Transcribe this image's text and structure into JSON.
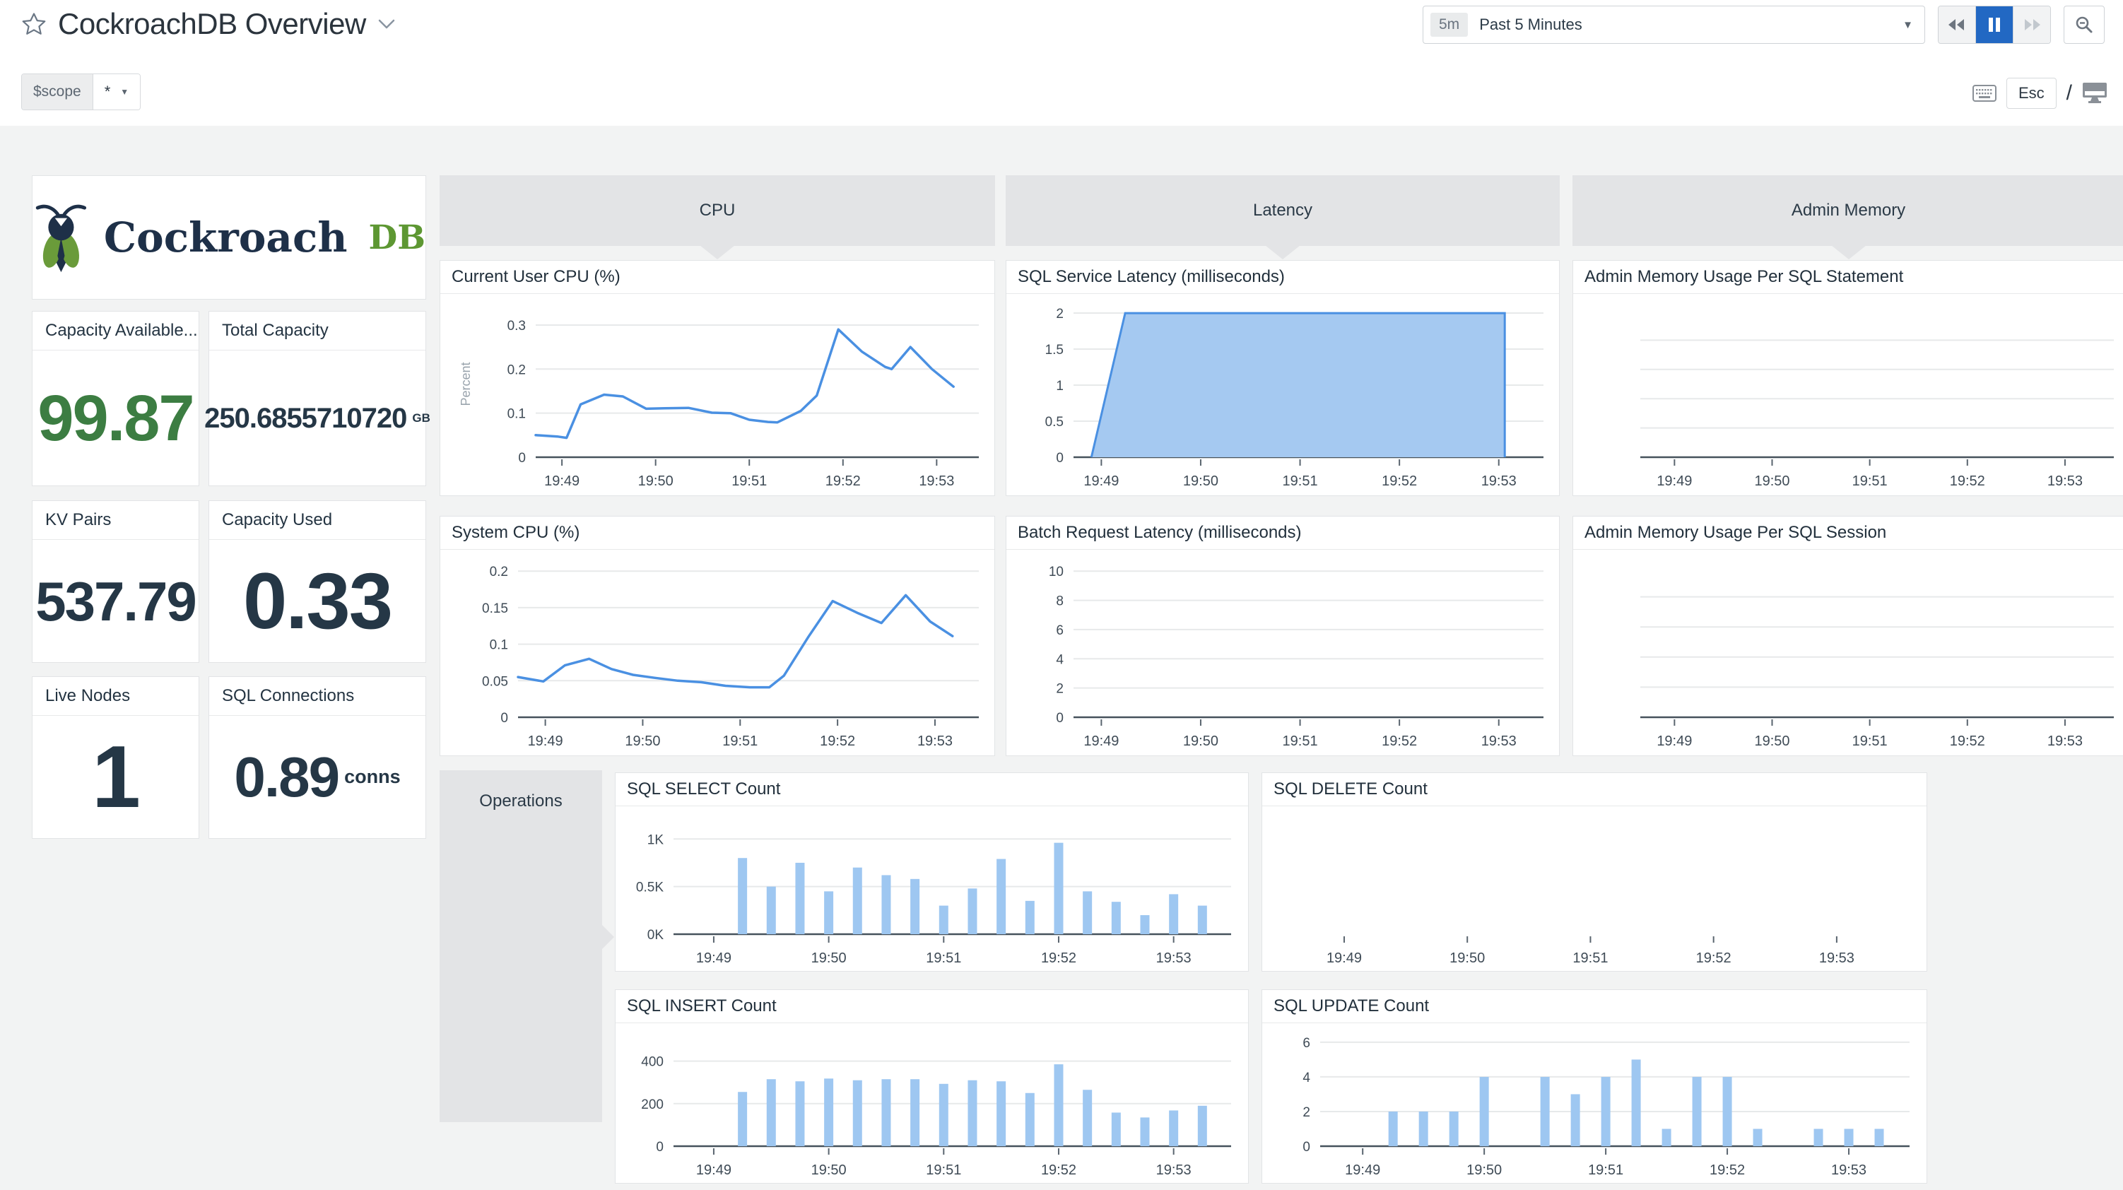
{
  "header": {
    "title": "CockroachDB Overview",
    "time_range": {
      "badge": "5m",
      "label": "Past 5 Minutes",
      "caret": "▼"
    },
    "scope_var": {
      "name": "$scope",
      "value": "*",
      "caret": "▼"
    },
    "esc_label": "Esc",
    "slash": "/"
  },
  "icons": {
    "favorite": "star-outline",
    "title_menu": "chevron-down",
    "rewind": "double-triangle-left",
    "pause": "pause-bars",
    "forward": "double-triangle-right",
    "zoom_out": "magnifier-minus",
    "keyboard": "keyboard",
    "display": "monitor"
  },
  "logo": {
    "brand": "Cockroach",
    "suffix": "DB"
  },
  "colors": {
    "accent_blue": "#2268c3",
    "line_blue": "#4a90e2",
    "area_fill": "#a5c9f1",
    "bar_fill": "#9ec7f1",
    "value_green": "#3c7d42",
    "logo_navy": "#1e3048",
    "logo_green": "#5d9732"
  },
  "groups": {
    "cpu": "CPU",
    "latency": "Latency",
    "admin_memory": "Admin Memory",
    "operations": "Operations"
  },
  "stats": [
    {
      "title": "Capacity Available...",
      "value": "99.87",
      "unit": "",
      "color": "#3c7d42"
    },
    {
      "title": "Total Capacity",
      "value": "250.6855710720",
      "unit": "GB",
      "color": "#253746"
    },
    {
      "title": "KV Pairs",
      "value": "537.79",
      "unit": "",
      "color": "#253746"
    },
    {
      "title": "Capacity Used",
      "value": "0.33",
      "unit": "",
      "color": "#253746"
    },
    {
      "title": "Live Nodes",
      "value": "1",
      "unit": "",
      "color": "#253746"
    },
    {
      "title": "SQL Connections",
      "value": "0.89",
      "unit": "conns",
      "color": "#253746"
    }
  ],
  "chart_data": [
    {
      "id": "current_user_cpu",
      "type": "line",
      "title": "Current User CPU (%)",
      "ylabel": "Percent",
      "ylim": [
        0,
        0.332
      ],
      "yticks": [
        {
          "v": 0,
          "t": "0"
        },
        {
          "v": 0.1,
          "t": "0.1"
        },
        {
          "v": 0.2,
          "t": "0.2"
        },
        {
          "v": 0.3,
          "t": "0.3"
        }
      ],
      "xlim": [
        48.72,
        53.45
      ],
      "xticks": [
        {
          "v": 49,
          "t": "19:49"
        },
        {
          "v": 50,
          "t": "19:50"
        },
        {
          "v": 51,
          "t": "19:51"
        },
        {
          "v": 52,
          "t": "19:52"
        },
        {
          "v": 53,
          "t": "19:53"
        }
      ],
      "points": [
        [
          48.72,
          0.05
        ],
        [
          48.95,
          0.047
        ],
        [
          49.05,
          0.044
        ],
        [
          49.2,
          0.12
        ],
        [
          49.45,
          0.142
        ],
        [
          49.65,
          0.138
        ],
        [
          49.9,
          0.11
        ],
        [
          50.1,
          0.111
        ],
        [
          50.35,
          0.112
        ],
        [
          50.6,
          0.101
        ],
        [
          50.8,
          0.1
        ],
        [
          51.0,
          0.085
        ],
        [
          51.2,
          0.08
        ],
        [
          51.3,
          0.079
        ],
        [
          51.55,
          0.105
        ],
        [
          51.72,
          0.14
        ],
        [
          51.95,
          0.29
        ],
        [
          52.2,
          0.24
        ],
        [
          52.45,
          0.205
        ],
        [
          52.52,
          0.2
        ],
        [
          52.72,
          0.25
        ],
        [
          52.95,
          0.2
        ],
        [
          53.18,
          0.16
        ]
      ],
      "color": "#4a90e2",
      "margins": {
        "l": 135,
        "r": 22,
        "t": 24,
        "b": 54
      }
    },
    {
      "id": "sql_service_latency",
      "type": "area",
      "title": "SQL Service Latency (milliseconds)",
      "ylim": [
        0,
        2.03
      ],
      "yticks": [
        {
          "v": 0,
          "t": "0"
        },
        {
          "v": 0.5,
          "t": "0.5"
        },
        {
          "v": 1,
          "t": "1"
        },
        {
          "v": 1.5,
          "t": "1.5"
        },
        {
          "v": 2,
          "t": "2"
        }
      ],
      "xlim": [
        48.72,
        53.45
      ],
      "xticks": [
        {
          "v": 49,
          "t": "19:49"
        },
        {
          "v": 50,
          "t": "19:50"
        },
        {
          "v": 51,
          "t": "19:51"
        },
        {
          "v": 52,
          "t": "19:52"
        },
        {
          "v": 53,
          "t": "19:53"
        }
      ],
      "points": [
        [
          48.9,
          0
        ],
        [
          49.24,
          2
        ],
        [
          53.06,
          2
        ]
      ],
      "color": "#4a90e2",
      "fill": "#a5c9f1",
      "margins": {
        "l": 95,
        "r": 22,
        "t": 24,
        "b": 54
      }
    },
    {
      "id": "admin_mem_statement",
      "type": "empty",
      "title": "Admin Memory Usage Per SQL Statement",
      "gridlines": 4,
      "xlim": [
        48.65,
        53.5
      ],
      "xticks": [
        {
          "v": 49,
          "t": "19:49"
        },
        {
          "v": 50,
          "t": "19:50"
        },
        {
          "v": 51,
          "t": "19:51"
        },
        {
          "v": 52,
          "t": "19:52"
        },
        {
          "v": 53,
          "t": "19:53"
        }
      ],
      "margins": {
        "l": 95,
        "r": 14,
        "t": 24,
        "b": 54
      }
    },
    {
      "id": "system_cpu",
      "type": "line",
      "title": "System CPU (%)",
      "ylim": [
        0,
        0.206
      ],
      "yticks": [
        {
          "v": 0,
          "t": "0"
        },
        {
          "v": 0.05,
          "t": "0.05"
        },
        {
          "v": 0.1,
          "t": "0.1"
        },
        {
          "v": 0.15,
          "t": "0.15"
        },
        {
          "v": 0.2,
          "t": "0.2"
        }
      ],
      "xlim": [
        48.72,
        53.45
      ],
      "xticks": [
        {
          "v": 49,
          "t": "19:49"
        },
        {
          "v": 50,
          "t": "19:50"
        },
        {
          "v": 51,
          "t": "19:51"
        },
        {
          "v": 52,
          "t": "19:52"
        },
        {
          "v": 53,
          "t": "19:53"
        }
      ],
      "points": [
        [
          48.72,
          0.055
        ],
        [
          48.98,
          0.049
        ],
        [
          49.2,
          0.071
        ],
        [
          49.45,
          0.08
        ],
        [
          49.68,
          0.066
        ],
        [
          49.9,
          0.058
        ],
        [
          50.12,
          0.054
        ],
        [
          50.36,
          0.05
        ],
        [
          50.6,
          0.048
        ],
        [
          50.85,
          0.043
        ],
        [
          51.1,
          0.041
        ],
        [
          51.3,
          0.041
        ],
        [
          51.45,
          0.057
        ],
        [
          51.7,
          0.11
        ],
        [
          51.95,
          0.159
        ],
        [
          52.2,
          0.143
        ],
        [
          52.45,
          0.129
        ],
        [
          52.7,
          0.167
        ],
        [
          52.95,
          0.131
        ],
        [
          53.18,
          0.111
        ]
      ],
      "color": "#4a90e2",
      "margins": {
        "l": 110,
        "r": 22,
        "t": 24,
        "b": 54
      }
    },
    {
      "id": "batch_request_latency",
      "type": "empty",
      "title": "Batch Request Latency (milliseconds)",
      "ylim": [
        0,
        10.3
      ],
      "yticks": [
        {
          "v": 0,
          "t": "0"
        },
        {
          "v": 2,
          "t": "2"
        },
        {
          "v": 4,
          "t": "4"
        },
        {
          "v": 6,
          "t": "6"
        },
        {
          "v": 8,
          "t": "8"
        },
        {
          "v": 10,
          "t": "10"
        }
      ],
      "xlim": [
        48.72,
        53.45
      ],
      "xticks": [
        {
          "v": 49,
          "t": "19:49"
        },
        {
          "v": 50,
          "t": "19:50"
        },
        {
          "v": 51,
          "t": "19:51"
        },
        {
          "v": 52,
          "t": "19:52"
        },
        {
          "v": 53,
          "t": "19:53"
        }
      ],
      "margins": {
        "l": 95,
        "r": 22,
        "t": 24,
        "b": 54
      }
    },
    {
      "id": "admin_mem_session",
      "type": "empty",
      "title": "Admin Memory Usage Per SQL Session",
      "gridlines": 4,
      "xlim": [
        48.65,
        53.5
      ],
      "xticks": [
        {
          "v": 49,
          "t": "19:49"
        },
        {
          "v": 50,
          "t": "19:50"
        },
        {
          "v": 51,
          "t": "19:51"
        },
        {
          "v": 52,
          "t": "19:52"
        },
        {
          "v": 53,
          "t": "19:53"
        }
      ],
      "margins": {
        "l": 95,
        "r": 14,
        "t": 24,
        "b": 54
      }
    },
    {
      "id": "sql_select_count",
      "type": "bar",
      "title": "SQL SELECT Count",
      "ylim": [
        0,
        1180
      ],
      "yticks": [
        {
          "v": 0,
          "t": "0K"
        },
        {
          "v": 500,
          "t": "0.5K"
        },
        {
          "v": 1000,
          "t": "1K"
        }
      ],
      "xlim": [
        48.65,
        53.5
      ],
      "xticks": [
        {
          "v": 49,
          "t": "19:49"
        },
        {
          "v": 50,
          "t": "19:50"
        },
        {
          "v": 51,
          "t": "19:51"
        },
        {
          "v": 52,
          "t": "19:52"
        },
        {
          "v": 53,
          "t": "19:53"
        }
      ],
      "bars": {
        "x": [
          49.25,
          49.5,
          49.75,
          50,
          50.25,
          50.5,
          50.75,
          51,
          51.25,
          51.5,
          51.75,
          52,
          52.25,
          52.5,
          52.75,
          53,
          53.25
        ],
        "values": [
          800,
          500,
          750,
          450,
          700,
          620,
          580,
          300,
          480,
          790,
          350,
          960,
          450,
          340,
          200,
          420,
          300
        ]
      },
      "fill": "#9ec7f1",
      "margins": {
        "l": 82,
        "r": 24,
        "t": 22,
        "b": 52
      }
    },
    {
      "id": "sql_delete_count",
      "type": "empty",
      "title": "SQL DELETE Count",
      "baseline": false,
      "xlim": [
        48.65,
        53.5
      ],
      "xticks": [
        {
          "v": 49,
          "t": "19:49"
        },
        {
          "v": 50,
          "t": "19:50"
        },
        {
          "v": 51,
          "t": "19:51"
        },
        {
          "v": 52,
          "t": "19:52"
        },
        {
          "v": 53,
          "t": "19:53"
        }
      ],
      "margins": {
        "l": 55,
        "r": 40,
        "t": 22,
        "b": 52
      }
    },
    {
      "id": "sql_insert_count",
      "type": "bar",
      "title": "SQL INSERT Count",
      "ylim": [
        0,
        505
      ],
      "yticks": [
        {
          "v": 0,
          "t": "0"
        },
        {
          "v": 200,
          "t": "200"
        },
        {
          "v": 400,
          "t": "400"
        }
      ],
      "xlim": [
        48.65,
        53.5
      ],
      "xticks": [
        {
          "v": 49,
          "t": "19:49"
        },
        {
          "v": 50,
          "t": "19:50"
        },
        {
          "v": 51,
          "t": "19:51"
        },
        {
          "v": 52,
          "t": "19:52"
        },
        {
          "v": 53,
          "t": "19:53"
        }
      ],
      "bars": {
        "x": [
          49.25,
          49.5,
          49.75,
          50,
          50.25,
          50.5,
          50.75,
          51,
          51.25,
          51.5,
          51.75,
          52,
          52.25,
          52.5,
          52.75,
          53,
          53.25
        ],
        "values": [
          255,
          315,
          305,
          318,
          310,
          315,
          315,
          293,
          310,
          305,
          250,
          385,
          265,
          158,
          135,
          168,
          190
        ]
      },
      "fill": "#9ec7f1",
      "margins": {
        "l": 82,
        "r": 24,
        "t": 22,
        "b": 52
      }
    },
    {
      "id": "sql_update_count",
      "type": "bar",
      "title": "SQL UPDATE Count",
      "ylim": [
        0,
        6.2
      ],
      "yticks": [
        {
          "v": 0,
          "t": "0"
        },
        {
          "v": 2,
          "t": "2"
        },
        {
          "v": 4,
          "t": "4"
        },
        {
          "v": 6,
          "t": "6"
        }
      ],
      "xlim": [
        48.65,
        53.5
      ],
      "xticks": [
        {
          "v": 49,
          "t": "19:49"
        },
        {
          "v": 50,
          "t": "19:50"
        },
        {
          "v": 51,
          "t": "19:51"
        },
        {
          "v": 52,
          "t": "19:52"
        },
        {
          "v": 53,
          "t": "19:53"
        }
      ],
      "bars": {
        "x": [
          49.25,
          49.5,
          49.75,
          50,
          50.25,
          50.5,
          50.75,
          51,
          51.25,
          51.5,
          51.75,
          52,
          52.25,
          52.5,
          52.75,
          53,
          53.25
        ],
        "values": [
          2,
          2,
          2,
          4,
          0,
          4,
          3,
          4,
          5,
          1,
          4,
          4,
          1,
          0,
          1,
          1,
          1
        ]
      },
      "fill": "#9ec7f1",
      "margins": {
        "l": 82,
        "r": 24,
        "t": 22,
        "b": 52
      }
    }
  ]
}
